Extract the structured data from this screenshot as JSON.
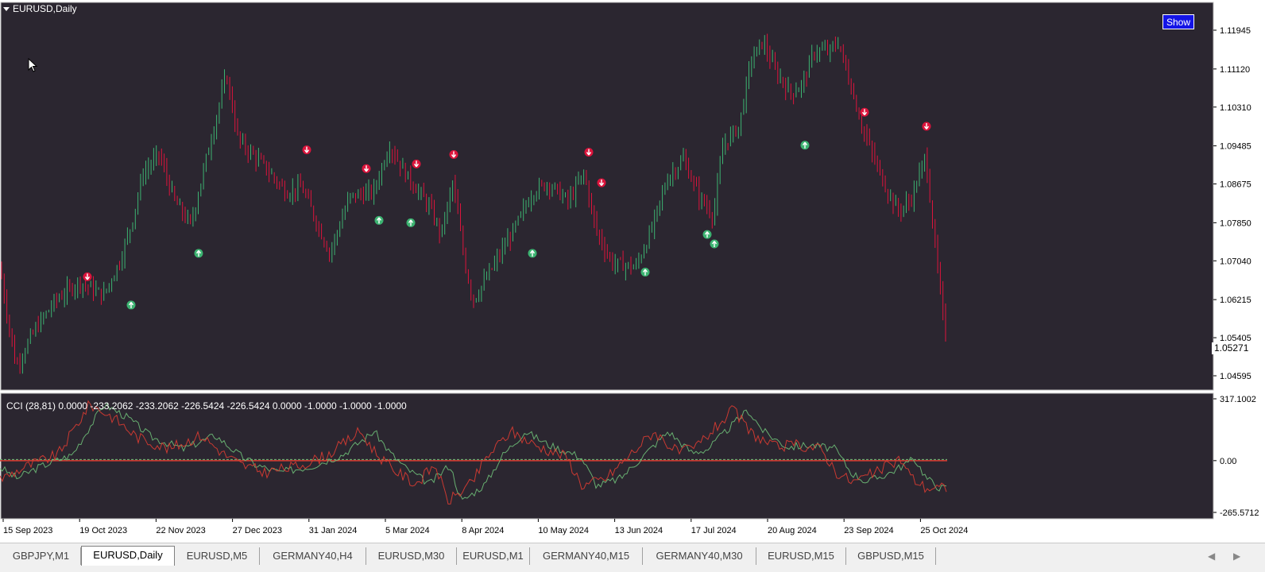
{
  "chart_title": "EURUSD,Daily",
  "show_button": "Show",
  "cci_label": "CCI (28,81) 0.0000 -233.2062 -233.2062 -226.5424 -226.5424 0.0000 -1.0000 -1.0000 -1.0000",
  "last_price": "1.05271",
  "colors": {
    "background": "#2b2630",
    "bull": "#3cb371",
    "bear": "#dc143c",
    "cci_green": "#6ebe78",
    "cci_red": "#dc3c32",
    "button": "#1414e6"
  },
  "price_axis": {
    "ticks": [
      "1.11945",
      "1.11120",
      "1.10310",
      "1.09485",
      "1.08675",
      "1.07850",
      "1.07040",
      "1.06215",
      "1.05405",
      "1.04595"
    ]
  },
  "cci_axis": {
    "ticks": [
      "317.1002",
      "0.00",
      "-265.5712"
    ]
  },
  "time_axis": {
    "labels": [
      "15 Sep 2023",
      "19 Oct 2023",
      "22 Nov 2023",
      "27 Dec 2023",
      "31 Jan 2024",
      "5 Mar 2024",
      "8 Apr 2024",
      "10 May 2024",
      "13 Jun 2024",
      "17 Jul 2024",
      "20 Aug 2024",
      "23 Sep 2024",
      "25 Oct 2024"
    ]
  },
  "tabs": [
    {
      "label": "GBPJPY,M1",
      "active": false
    },
    {
      "label": "EURUSD,Daily",
      "active": true
    },
    {
      "label": "EURUSD,M5",
      "active": false
    },
    {
      "label": "GERMANY40,H4",
      "active": false
    },
    {
      "label": "EURUSD,M30",
      "active": false
    },
    {
      "label": "EURUSD,M1",
      "active": false
    },
    {
      "label": "GERMANY40,M15",
      "active": false
    },
    {
      "label": "GERMANY40,M30",
      "active": false
    },
    {
      "label": "EURUSD,M15",
      "active": false
    },
    {
      "label": "GBPUSD,M15",
      "active": false
    }
  ],
  "chart_data": {
    "type": "candlestick",
    "price_key_points": [
      [
        0,
        1.069
      ],
      [
        8,
        1.06
      ],
      [
        20,
        1.048
      ],
      [
        45,
        1.056
      ],
      [
        70,
        1.062
      ],
      [
        100,
        1.066
      ],
      [
        130,
        1.063
      ],
      [
        150,
        1.07
      ],
      [
        165,
        1.078
      ],
      [
        180,
        1.089
      ],
      [
        200,
        1.093
      ],
      [
        220,
        1.083
      ],
      [
        240,
        1.078
      ],
      [
        265,
        1.096
      ],
      [
        285,
        1.11
      ],
      [
        300,
        1.096
      ],
      [
        330,
        1.091
      ],
      [
        360,
        1.085
      ],
      [
        380,
        1.086
      ],
      [
        400,
        1.078
      ],
      [
        415,
        1.072
      ],
      [
        440,
        1.084
      ],
      [
        470,
        1.085
      ],
      [
        490,
        1.095
      ],
      [
        510,
        1.089
      ],
      [
        540,
        1.082
      ],
      [
        555,
        1.076
      ],
      [
        570,
        1.087
      ],
      [
        585,
        1.07
      ],
      [
        595,
        1.062
      ],
      [
        610,
        1.066
      ],
      [
        630,
        1.072
      ],
      [
        650,
        1.078
      ],
      [
        670,
        1.085
      ],
      [
        690,
        1.087
      ],
      [
        715,
        1.083
      ],
      [
        735,
        1.089
      ],
      [
        750,
        1.077
      ],
      [
        770,
        1.07
      ],
      [
        800,
        1.069
      ],
      [
        820,
        1.077
      ],
      [
        840,
        1.088
      ],
      [
        860,
        1.092
      ],
      [
        880,
        1.084
      ],
      [
        898,
        1.08
      ],
      [
        910,
        1.095
      ],
      [
        930,
        1.099
      ],
      [
        945,
        1.113
      ],
      [
        960,
        1.117
      ],
      [
        975,
        1.111
      ],
      [
        995,
        1.106
      ],
      [
        1010,
        1.108
      ],
      [
        1025,
        1.115
      ],
      [
        1045,
        1.115
      ],
      [
        1055,
        1.117
      ],
      [
        1070,
        1.108
      ],
      [
        1085,
        1.099
      ],
      [
        1100,
        1.092
      ],
      [
        1115,
        1.086
      ],
      [
        1130,
        1.081
      ],
      [
        1145,
        1.083
      ],
      [
        1160,
        1.09
      ],
      [
        1165,
        1.093
      ],
      [
        1175,
        1.076
      ],
      [
        1185,
        1.061
      ],
      [
        1192,
        1.052
      ]
    ],
    "signals_up": [
      [
        165,
        1.061
      ],
      [
        250,
        1.072
      ],
      [
        477,
        1.079
      ],
      [
        517,
        1.0785
      ],
      [
        670,
        1.072
      ],
      [
        812,
        1.068
      ],
      [
        890,
        1.076
      ],
      [
        899,
        1.074
      ],
      [
        1013,
        1.095
      ]
    ],
    "signals_down": [
      [
        110,
        1.067
      ],
      [
        386,
        1.094
      ],
      [
        461,
        1.09
      ],
      [
        524,
        1.091
      ],
      [
        571,
        1.093
      ],
      [
        741,
        1.0935
      ],
      [
        757,
        1.087
      ],
      [
        1088,
        1.102
      ],
      [
        1166,
        1.099
      ]
    ],
    "cci_key_points": [
      [
        0,
        -10
      ],
      [
        30,
        -90
      ],
      [
        60,
        -30
      ],
      [
        100,
        30
      ],
      [
        140,
        290
      ],
      [
        170,
        220
      ],
      [
        200,
        120
      ],
      [
        240,
        60
      ],
      [
        280,
        130
      ],
      [
        310,
        30
      ],
      [
        330,
        -20
      ],
      [
        360,
        -60
      ],
      [
        400,
        -30
      ],
      [
        440,
        30
      ],
      [
        480,
        150
      ],
      [
        500,
        40
      ],
      [
        520,
        -40
      ],
      [
        550,
        -120
      ],
      [
        575,
        -20
      ],
      [
        590,
        -210
      ],
      [
        620,
        -120
      ],
      [
        640,
        20
      ],
      [
        670,
        150
      ],
      [
        700,
        80
      ],
      [
        740,
        20
      ],
      [
        760,
        -130
      ],
      [
        790,
        -90
      ],
      [
        820,
        30
      ],
      [
        850,
        150
      ],
      [
        880,
        40
      ],
      [
        900,
        60
      ],
      [
        920,
        140
      ],
      [
        950,
        260
      ],
      [
        970,
        150
      ],
      [
        1000,
        70
      ],
      [
        1030,
        80
      ],
      [
        1060,
        60
      ],
      [
        1080,
        -60
      ],
      [
        1100,
        -110
      ],
      [
        1130,
        -60
      ],
      [
        1160,
        10
      ],
      [
        1175,
        -90
      ],
      [
        1192,
        -140
      ]
    ],
    "cci_range": [
      -265.5712,
      317.1002
    ]
  }
}
